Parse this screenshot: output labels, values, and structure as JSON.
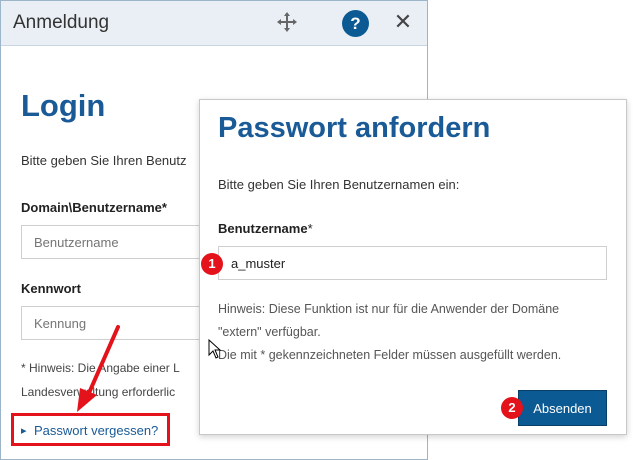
{
  "dialog": {
    "title": "Anmeldung",
    "help_label": "?",
    "close_label": "✕",
    "heading": "Login",
    "intro": "Bitte geben Sie Ihren Benutz",
    "domain_label": "Domain\\Benutzername*",
    "username_placeholder": "Benutzername",
    "password_label": "Kennwort",
    "password_placeholder": "Kennung",
    "note_line1": "* Hinweis: Die Angabe einer L",
    "note_line2": "Landesverwaltung erforderlic",
    "forgot_link": "Passwort vergessen?"
  },
  "popup": {
    "heading": "Passwort anfordern",
    "intro": "Bitte geben Sie Ihren Benutzernamen ein:",
    "username_label": "Benutzername",
    "username_required": "*",
    "username_value": "a_muster",
    "hint_line1": "Hinweis: Diese Funktion ist nur für die Anwender der Domäne",
    "hint_line2": "\"extern\" verfügbar.",
    "hint_line3": "Die mit * gekennzeichneten Felder müssen ausgefüllt werden.",
    "submit_label": "Absenden"
  },
  "annotations": {
    "step1": "1",
    "step2": "2",
    "color": "#e4121b"
  },
  "colors": {
    "accent": "#1a5a97",
    "button": "#0c5a93"
  }
}
